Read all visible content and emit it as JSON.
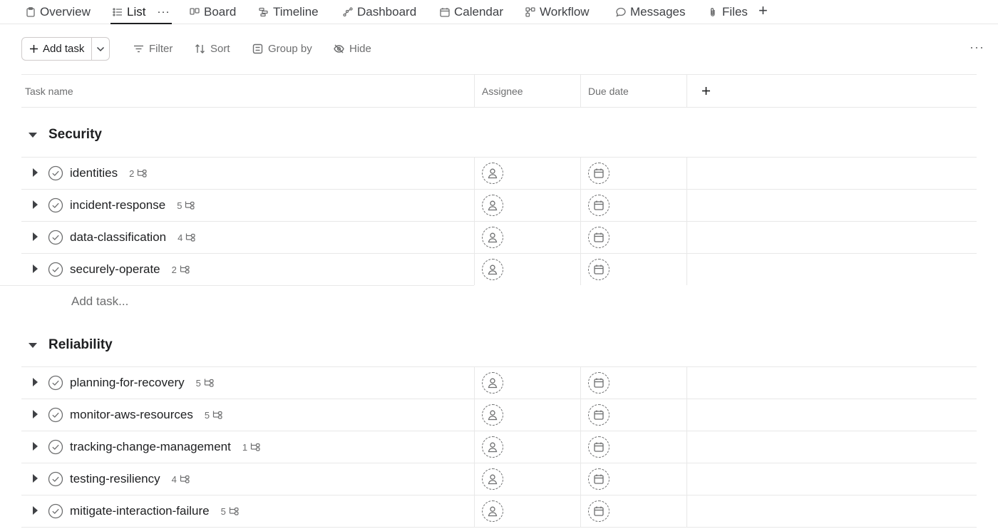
{
  "tabs": [
    {
      "label": "Overview",
      "icon": "clipboard-icon"
    },
    {
      "label": "List",
      "icon": "list-icon",
      "active": true
    },
    {
      "label": "Board",
      "icon": "board-icon"
    },
    {
      "label": "Timeline",
      "icon": "timeline-icon"
    },
    {
      "label": "Dashboard",
      "icon": "dashboard-icon"
    },
    {
      "label": "Calendar",
      "icon": "calendar-icon"
    },
    {
      "label": "Workflow",
      "icon": "workflow-icon"
    },
    {
      "label": "Messages",
      "icon": "message-icon"
    },
    {
      "label": "Files",
      "icon": "paperclip-icon"
    }
  ],
  "tab_more": "···",
  "toolbar": {
    "add_task": "Add task",
    "filter": "Filter",
    "sort": "Sort",
    "group_by": "Group by",
    "hide": "Hide",
    "more": "···"
  },
  "columns": {
    "task_name": "Task name",
    "assignee": "Assignee",
    "due_date": "Due date"
  },
  "sections": [
    {
      "title": "Security",
      "add_task_placeholder": "Add task...",
      "tasks": [
        {
          "name": "identities",
          "subtasks": "2"
        },
        {
          "name": "incident-response",
          "subtasks": "5"
        },
        {
          "name": "data-classification",
          "subtasks": "4"
        },
        {
          "name": "securely-operate",
          "subtasks": "2"
        }
      ]
    },
    {
      "title": "Reliability",
      "tasks": [
        {
          "name": "planning-for-recovery",
          "subtasks": "5"
        },
        {
          "name": "monitor-aws-resources",
          "subtasks": "5"
        },
        {
          "name": "tracking-change-management",
          "subtasks": "1"
        },
        {
          "name": "testing-resiliency",
          "subtasks": "4"
        },
        {
          "name": "mitigate-interaction-failure",
          "subtasks": "5"
        }
      ]
    }
  ],
  "colors": {
    "text": "#1e1f21",
    "muted": "#6d6e6f",
    "border": "#e8e8e8"
  }
}
